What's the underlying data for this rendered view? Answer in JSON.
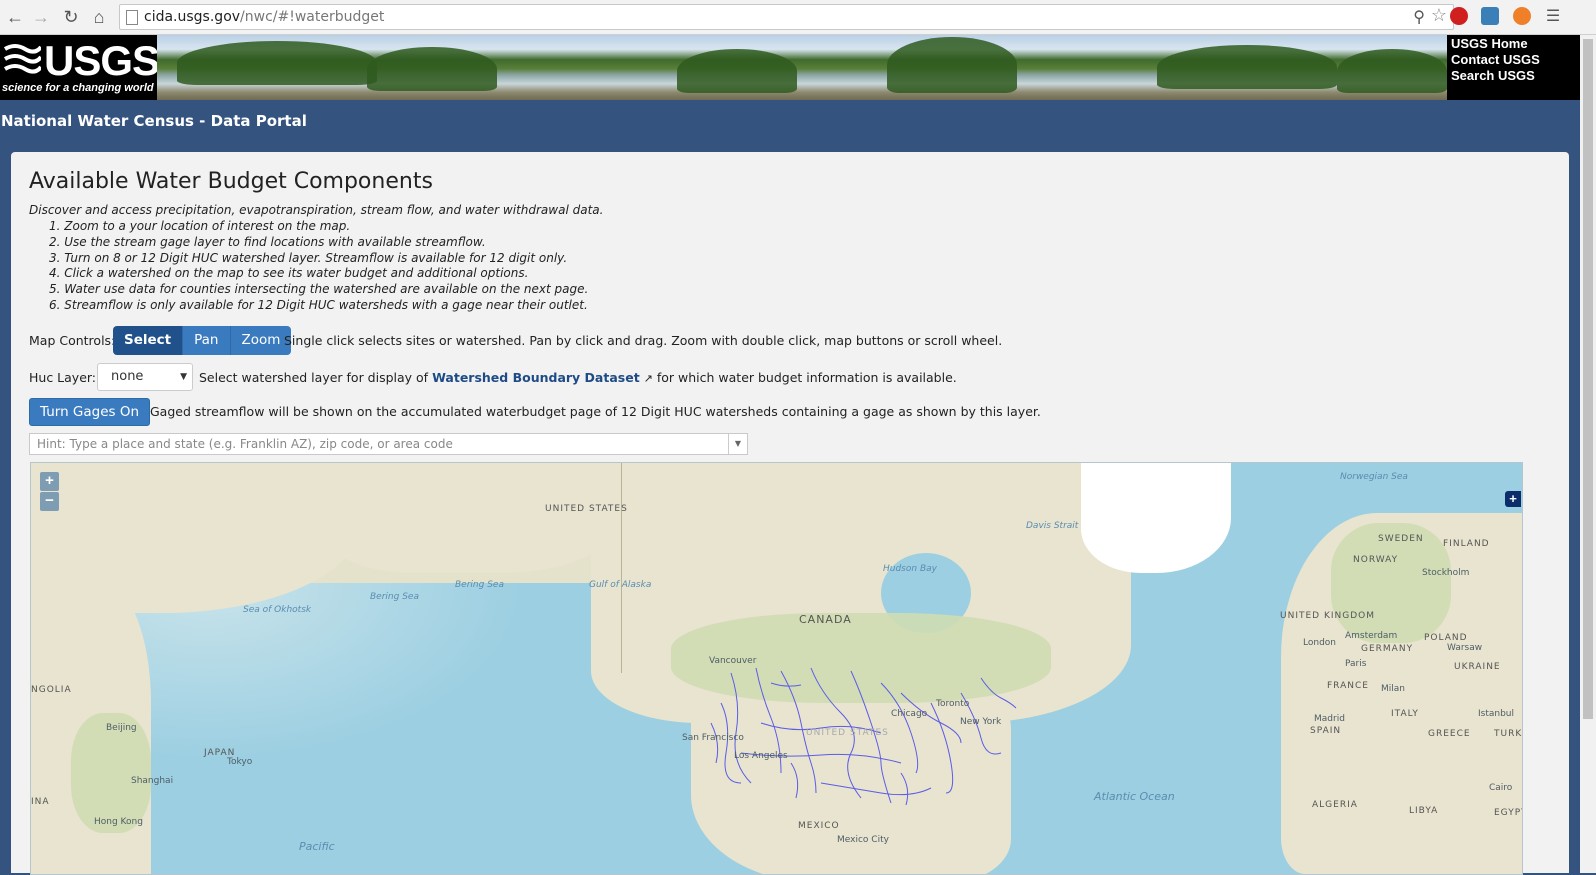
{
  "browser": {
    "url_host": "cida.usgs.gov",
    "url_path": "/nwc/#!waterbudget"
  },
  "banner": {
    "logo_text": "USGS",
    "logo_tagline": "science for a changing world",
    "links": [
      "USGS Home",
      "Contact USGS",
      "Search USGS"
    ]
  },
  "site_title": "National Water Census - Data Portal",
  "main": {
    "title": "Available Water Budget Components",
    "intro": "Discover and access precipitation, evapotranspiration, stream flow, and water withdrawal data.",
    "steps": [
      "1. Zoom to a your location of interest on the map.",
      "2. Use the stream gage layer to find locations with available streamflow.",
      "3. Turn on 8 or 12 Digit HUC watershed layer. Streamflow is available for 12 digit only.",
      "4. Click a watershed on the map to see its water budget and additional options.",
      "5. Water use data for counties intersecting the watershed are available on the next page.",
      "6. Streamflow is only available for 12 Digit HUC watersheds with a gage near their outlet."
    ],
    "map_controls_label": "Map Controls:",
    "map_controls": [
      "Select",
      "Pan",
      "Zoom"
    ],
    "map_controls_active": "Select",
    "map_controls_help": "Single click selects sites or watershed. Pan by click and drag. Zoom with double click, map buttons or scroll wheel.",
    "huc_label": "Huc Layer:",
    "huc_value": "none",
    "huc_help_pre": "Select watershed layer for display of",
    "huc_link": "Watershed Boundary Dataset",
    "huc_help_post": "for which water budget information is available.",
    "gages_button": "Turn Gages On",
    "gages_help": "Gaged streamflow will be shown on the accumulated waterbudget page of 12 Digit HUC watersheds containing a gage as shown by this layer.",
    "search_placeholder": "Hint: Type a place and state (e.g. Franklin AZ), zip code, or area code"
  },
  "map": {
    "zoom_in": "+",
    "zoom_out": "−",
    "layer_switcher": "+",
    "labels": {
      "us_north": "UNITED STATES",
      "sea_okhotsk": "Sea of Okhotsk",
      "bering_sea_1": "Bering Sea",
      "bering_sea_2": "Bering Sea",
      "gulf_alaska": "Gulf of Alaska",
      "canada": "CANADA",
      "hudson_bay": "Hudson Bay",
      "davis_strait": "Davis Strait",
      "norwegian_sea": "Norwegian Sea",
      "vancouver": "Vancouver",
      "toronto": "Toronto",
      "chicago": "Chicago",
      "new_york": "New York",
      "san_francisco": "San Francisco",
      "los_angeles": "Los Angeles",
      "united_states": "UNITED STATES",
      "mexico": "MEXICO",
      "mexico_city": "Mexico City",
      "mongolia": "NGOLIA",
      "beijing": "Beijing",
      "japan": "JAPAN",
      "tokyo": "Tokyo",
      "shanghai": "Shanghai",
      "hong_kong": "Hong Kong",
      "china": "INA",
      "pacific": "Pacific",
      "atlantic": "Atlantic Ocean",
      "sweden": "SWEDEN",
      "finland": "FINLAND",
      "norway": "NORWAY",
      "stockholm": "Stockholm",
      "uk": "UNITED KINGDOM",
      "london": "London",
      "amsterdam": "Amsterdam",
      "germany": "GERMANY",
      "poland": "POLAND",
      "warsaw": "Warsaw",
      "paris": "Paris",
      "ukraine": "UKRAINE",
      "france": "FRANCE",
      "milan": "Milan",
      "madrid": "Madrid",
      "italy": "ITALY",
      "spain": "SPAIN",
      "istanbul": "Istanbul",
      "greece": "GREECE",
      "turkey": "TURKI",
      "algeria": "ALGERIA",
      "libya": "LIBYA",
      "egypt": "EGYPT",
      "cairo": "Cairo"
    }
  }
}
